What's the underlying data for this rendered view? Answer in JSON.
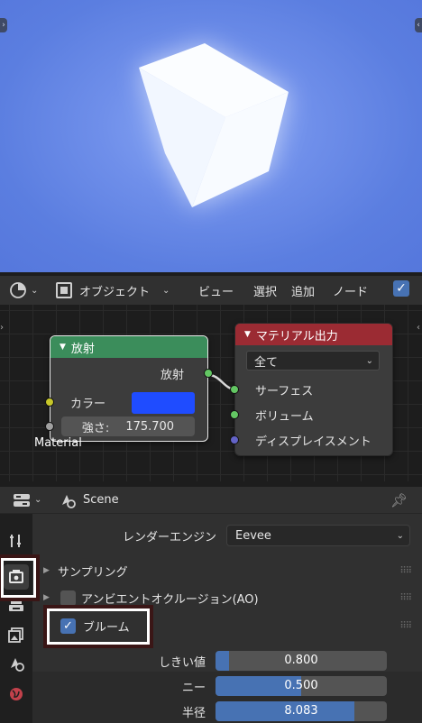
{
  "node_editor": {
    "mode_label": "オブジェクト",
    "menus": [
      "ビュー",
      "選択",
      "追加",
      "ノード"
    ],
    "use_nodes_checked": true
  },
  "emission_node": {
    "title": "放射",
    "output_label": "放射",
    "color_label": "カラー",
    "color_value": "#1f4cff",
    "strength_label": "強さ:",
    "strength_value": "175.700"
  },
  "output_node": {
    "title": "マテリアル出力",
    "target_value": "全て",
    "inputs": [
      "サーフェス",
      "ボリューム",
      "ディスプレイスメント"
    ]
  },
  "material_label": "Material",
  "properties": {
    "context_label": "Scene",
    "render_engine_label": "レンダーエンジン",
    "render_engine_value": "Eevee",
    "sampling_label": "サンプリング",
    "ao_label": "アンビエントオクルージョン(AO)",
    "ao_checked": false,
    "bloom_label": "ブルーム",
    "bloom_checked": true,
    "threshold_label": "しきい値",
    "threshold_value": "0.800",
    "threshold_fraction": 0.08,
    "knee_label": "ニー",
    "knee_value": "0.500",
    "knee_fraction": 0.5,
    "radius_label": "半径",
    "radius_value": "8.083",
    "radius_fraction": 0.81
  },
  "colors": {
    "viewport_bg": "#6f8fea",
    "emission_header": "#3b8d5b",
    "output_header": "#9b2b33",
    "accent": "#4772b3"
  },
  "icons": [
    "editor-type-icon",
    "object-mode-icon",
    "scene-icon",
    "pin-icon",
    "tool-tab-icon",
    "render-tab-icon",
    "output-tab-icon",
    "view-layer-tab-icon",
    "scene-tab-icon",
    "world-tab-icon"
  ]
}
